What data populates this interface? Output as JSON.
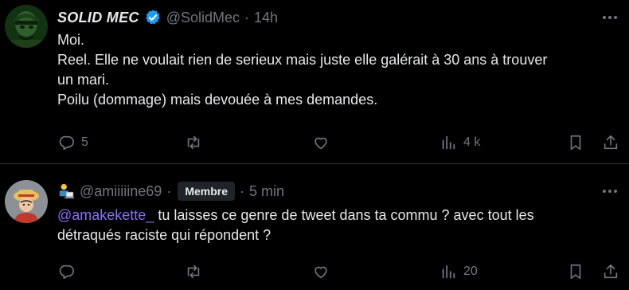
{
  "tweets": [
    {
      "display_name": "SOLID MEC",
      "handle": "@SolidMec",
      "separator": "·",
      "time": "14h",
      "lines": [
        "Moi.",
        "Reel. Elle ne voulait rien de serieux mais juste elle galérait à 30 ans à trouver",
        "un mari.",
        "Poilu (dommage) mais devouée à mes demandes."
      ],
      "counts": {
        "replies": "5",
        "retweets": "",
        "likes": "",
        "views": "4 k"
      },
      "icons": {
        "verified": "verified-badge-icon",
        "more": "more-icon"
      }
    },
    {
      "handle": "@amiiiiine69",
      "separator": "·",
      "badge": "Membre",
      "time": "5 min",
      "mention": "@amakekette_",
      "line1_rest": " tu laisses ce genre de tweet dans ta commu ? avec tout les",
      "line2": "détraqués raciste qui répondent ?",
      "counts": {
        "replies": "",
        "retweets": "",
        "likes": "",
        "views": "20"
      }
    }
  ],
  "colors": {
    "background": "#000000",
    "text": "#e7e9ea",
    "muted": "#71767b",
    "verified": "#1d9bf0",
    "mention": "#8a6ff7"
  }
}
